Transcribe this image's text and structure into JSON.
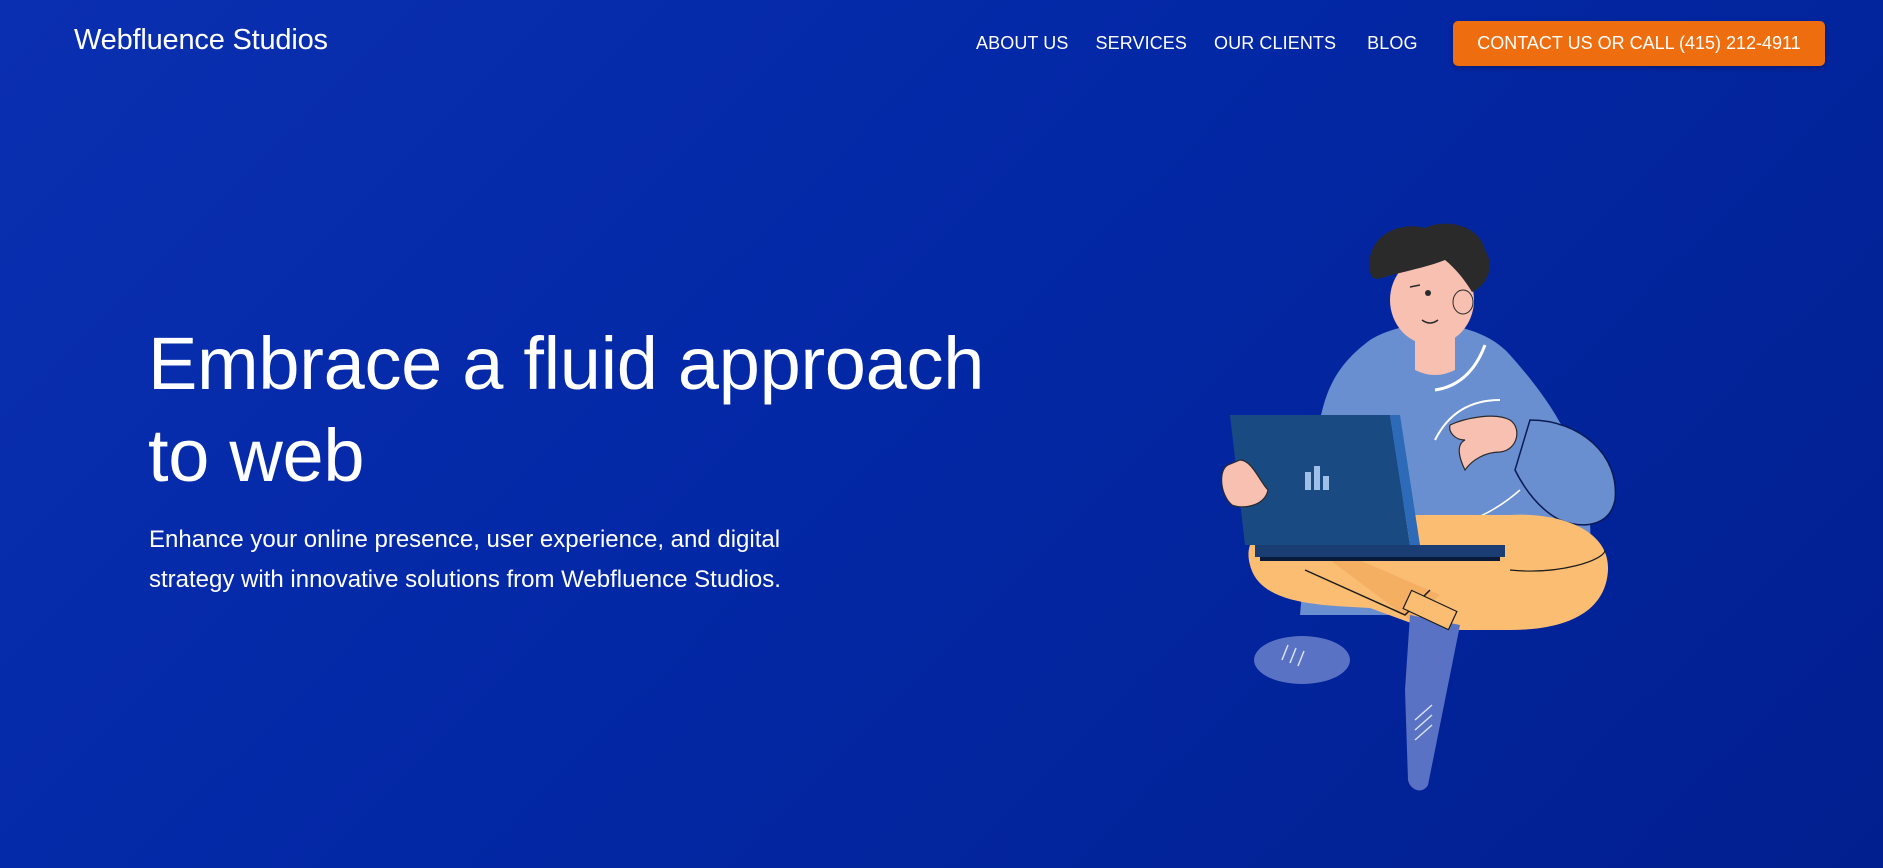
{
  "brand": {
    "name": "Webfluence Studios"
  },
  "nav": {
    "items": [
      {
        "label": "ABOUT US"
      },
      {
        "label": "SERVICES"
      },
      {
        "label": "OUR CLIENTS"
      },
      {
        "label": "BLOG"
      }
    ],
    "cta_label": "CONTACT US OR CALL (415) 212-4911"
  },
  "hero": {
    "title": "Embrace a fluid approach to web",
    "subtitle": "Enhance your online presence, user experience, and digital strategy with innovative solutions from Webfluence Studios."
  },
  "colors": {
    "background": "#0328a6",
    "cta": "#ee6d0f",
    "text": "#ffffff",
    "sweater": "#6a8fd0",
    "pants": "#fbbd72",
    "laptop": "#1a4a82",
    "skin": "#f8c0b0",
    "hair": "#2a2a2a"
  },
  "illustration": {
    "icon": "person-with-laptop-illustration"
  }
}
